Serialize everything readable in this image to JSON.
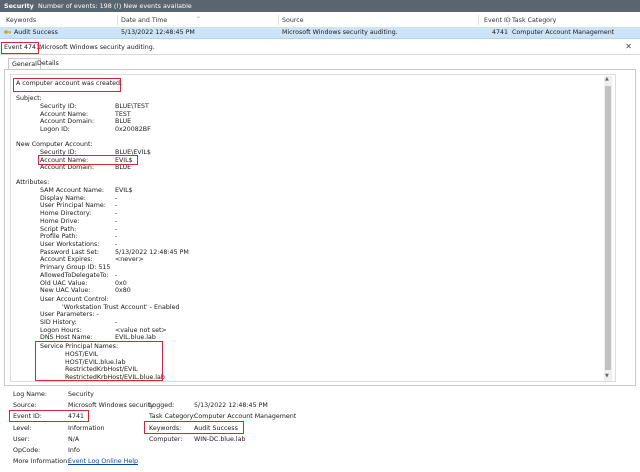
{
  "titlebar": {
    "title": "Security",
    "summary": "Number of events: 198 (!) New events available"
  },
  "columns": {
    "keywords": "Keywords",
    "date": "Date and Time",
    "source": "Source",
    "event_id": "Event ID",
    "task": "Task Category"
  },
  "selected_row": {
    "keywords": "Audit Success",
    "date": "5/13/2022 12:48:45 PM",
    "source": "Microsoft Windows security auditing.",
    "event_id": "4741",
    "task": "Computer Account Management"
  },
  "event_bar": {
    "id_label": "Event 4741,",
    "source": "Microsoft Windows security auditing."
  },
  "tabs": {
    "general": "General",
    "details": "Details"
  },
  "description": {
    "headline": "A computer account was created.",
    "subject_label": "Subject:",
    "subject": [
      [
        "Security ID:",
        "BLUE\\TEST"
      ],
      [
        "Account Name:",
        "TEST"
      ],
      [
        "Account Domain:",
        "BLUE"
      ],
      [
        "Logon ID:",
        "0x20082BF"
      ]
    ],
    "new_label": "New Computer Account:",
    "new_account": [
      [
        "Security ID:",
        "BLUE\\EVIL$"
      ],
      [
        "Account Name:",
        "EVIL$"
      ],
      [
        "Account Domain:",
        "BLUE"
      ]
    ],
    "attr_label": "Attributes:",
    "attributes": [
      [
        "SAM Account Name:",
        "EVIL$"
      ],
      [
        "Display Name:",
        "-"
      ],
      [
        "User Principal Name:",
        "-"
      ],
      [
        "Home Directory:",
        "-"
      ],
      [
        "Home Drive:",
        "-"
      ],
      [
        "Script Path:",
        "-"
      ],
      [
        "Profile Path:",
        "-"
      ],
      [
        "User Workstations:",
        "-"
      ],
      [
        "Password Last Set:",
        "5/13/2022 12:48:45 PM"
      ],
      [
        "Account Expires:",
        "<never>"
      ]
    ],
    "primary_group": "Primary Group ID: 515",
    "attributes2": [
      [
        "AllowedToDelegateTo:",
        "-"
      ],
      [
        "Old UAC Value:",
        "0x0"
      ],
      [
        "New UAC Value:",
        "0x80"
      ]
    ],
    "uac_label": "User Account Control:",
    "uac_value": "'Workstation Trust Account' - Enabled",
    "user_params": "User Parameters:  -",
    "attributes3": [
      [
        "SID History:",
        "-"
      ],
      [
        "Logon Hours:",
        "<value not set>"
      ],
      [
        "DNS Host Name:",
        "EVIL.blue.lab"
      ]
    ],
    "spn_label": "Service Principal Names:",
    "spns": [
      "HOST/EVIL",
      "HOST/EVIL.blue.lab",
      "RestrictedKrbHost/EVIL",
      "RestrictedKrbHost/EVIL.blue.lab"
    ]
  },
  "details": {
    "log_name_label": "Log Name:",
    "log_name": "Security",
    "source_label": "Source:",
    "source": "Microsoft Windows security",
    "logged_label": "Logged:",
    "logged": "5/13/2022 12:48:45 PM",
    "event_id_label": "Event ID:",
    "event_id": "4741",
    "task_label": "Task Category:",
    "task": "Computer Account Management",
    "level_label": "Level:",
    "level": "Information",
    "keywords_label": "Keywords:",
    "keywords": "Audit Success",
    "user_label": "User:",
    "user": "N/A",
    "computer_label": "Computer:",
    "computer": "WIN-DC.blue.lab",
    "opcode_label": "OpCode:",
    "opcode": "Info",
    "more_label": "More Information:",
    "more_link": "Event Log Online Help"
  }
}
